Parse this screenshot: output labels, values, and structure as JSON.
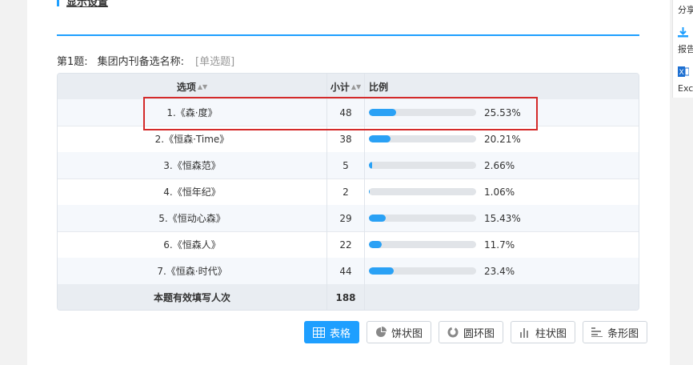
{
  "section": {
    "title": "显示设置"
  },
  "question": {
    "number": "第1题:",
    "text": "集团内刊备选名称:",
    "type": "[单选题]"
  },
  "table": {
    "headers": {
      "option": "选项",
      "count": "小计",
      "ratio": "比例"
    },
    "rows": [
      {
        "option": "1.《森·度》",
        "count": "48",
        "percent": "25.53%",
        "fraction": 0.2553
      },
      {
        "option": "2.《恒森·Time》",
        "count": "38",
        "percent": "20.21%",
        "fraction": 0.2021
      },
      {
        "option": "3.《恒森范》",
        "count": "5",
        "percent": "2.66%",
        "fraction": 0.0266
      },
      {
        "option": "4.《恒年纪》",
        "count": "2",
        "percent": "1.06%",
        "fraction": 0.0106
      },
      {
        "option": "5.《恒动心森》",
        "count": "29",
        "percent": "15.43%",
        "fraction": 0.1543
      },
      {
        "option": "6.《恒森人》",
        "count": "22",
        "percent": "11.7%",
        "fraction": 0.117
      },
      {
        "option": "7.《恒森·时代》",
        "count": "44",
        "percent": "23.4%",
        "fraction": 0.234
      }
    ],
    "footer": {
      "label": "本题有效填写人次",
      "total": "188"
    }
  },
  "view_buttons": [
    {
      "label": "表格",
      "icon": "table-icon",
      "active": true
    },
    {
      "label": "饼状图",
      "icon": "pie-chart-icon",
      "active": false
    },
    {
      "label": "圆环图",
      "icon": "donut-chart-icon",
      "active": false
    },
    {
      "label": "柱状图",
      "icon": "bar-chart-icon",
      "active": false
    },
    {
      "label": "条形图",
      "icon": "horizontal-bar-icon",
      "active": false
    }
  ],
  "sidebar": {
    "share": "分享",
    "report": "报告",
    "excel": "Excel"
  },
  "colors": {
    "accent": "#1e9fff",
    "bar_fill": "#2aa1f5",
    "highlight": "#d42a2a"
  }
}
